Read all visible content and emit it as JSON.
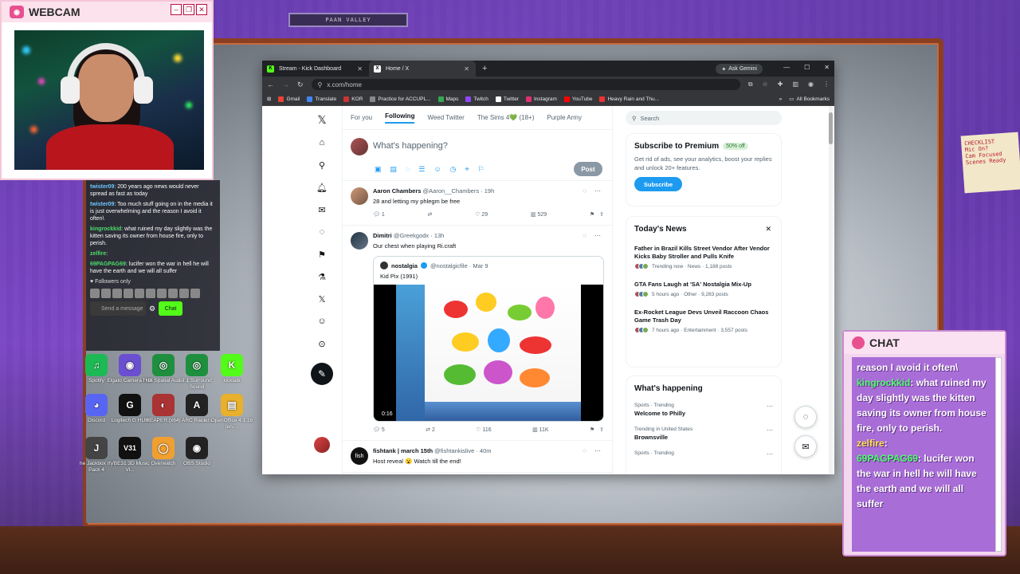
{
  "overlay": {
    "webcam_title": "WEBCAM",
    "chat_title": "CHAT",
    "sign_text": "PAAN VALLEY",
    "sticky_note": "CHECKLIST\nMic On?\nCam Focused\nScenes Ready"
  },
  "left_chat": {
    "messages": [
      {
        "user": "twister09",
        "text": ": 200 years ago news would never spread as fast as today"
      },
      {
        "user": "twister09",
        "text": ": Too much stuff going on in the media it is just overwhelming and the reason I avoid it often\\"
      },
      {
        "user": "kingrockkid",
        "text": ": what ruined my day slightly was the kitten saving its owner from house fire, only to perish."
      },
      {
        "user": "zelfire",
        "text": ":"
      },
      {
        "user": "69PAGPAG69",
        "text": ": lucifer won the war in hell he will have the earth and we will all suffer"
      }
    ],
    "followers_only": "Followers only",
    "send_placeholder": "Send a message",
    "chat_button": "Chat"
  },
  "right_chat": {
    "lines": [
      {
        "user": "",
        "text": "reason I avoid it often\\"
      },
      {
        "user": "kingrockkid",
        "text": ": what ruined my day slightly was the kitten saving its owner from house fire, only to perish."
      },
      {
        "user": "zelfire",
        "text": ":"
      },
      {
        "user": "69PAGPAG69",
        "text": ": lucifer won the war in hell he will have the earth and we will all suffer"
      }
    ]
  },
  "desktop_icons": [
    {
      "label": "Spotify",
      "color": "#1db954",
      "glyph": "♫"
    },
    {
      "label": "Elgato Camera Hub",
      "color": "#6a4fd0",
      "glyph": "◉"
    },
    {
      "label": "THX Spatial Audio",
      "color": "#1e8f3e",
      "glyph": "◎"
    },
    {
      "label": "7.1 Surround Sound",
      "color": "#1e8f3e",
      "glyph": "◎"
    },
    {
      "label": "kicklatk",
      "color": "#53fc18",
      "glyph": "K"
    },
    {
      "label": "Discord",
      "color": "#5865f2",
      "glyph": "◕"
    },
    {
      "label": "Logitech G HUB",
      "color": "#111111",
      "glyph": "G"
    },
    {
      "label": "REAPER (x64)",
      "color": "#a33",
      "glyph": "◐"
    },
    {
      "label": "ARC Raiders",
      "color": "#222222",
      "glyph": "A"
    },
    {
      "label": "OpenOffice 4.1.16 (en-...",
      "color": "#e8b02c",
      "glyph": "▤"
    },
    {
      "label": "he Jackbox rty Pack 4",
      "color": "#444",
      "glyph": "J"
    },
    {
      "label": "VBE31 3D Music Vi...",
      "color": "#111",
      "glyph": "V31"
    },
    {
      "label": "Overwatch",
      "color": "#f0a030",
      "glyph": "◯"
    },
    {
      "label": "OBS Studio",
      "color": "#222",
      "glyph": "◉"
    }
  ],
  "browser": {
    "tabs": [
      {
        "label": "Stream - Kick Dashboard",
        "active": false,
        "fav": "K",
        "fav_color": "#53fc18"
      },
      {
        "label": "Home / X",
        "active": true,
        "fav": "X",
        "fav_color": "#ffffff"
      }
    ],
    "ask_gemini": "Ask Gemini",
    "url": "x.com/home",
    "bookmarks": [
      {
        "label": "Gmail",
        "color": "#ea4335"
      },
      {
        "label": "Translate",
        "color": "#4285f4"
      },
      {
        "label": "KOR",
        "color": "#c33"
      },
      {
        "label": "Practice for ACCUPL...",
        "color": "#888"
      },
      {
        "label": "Maps",
        "color": "#34a853"
      },
      {
        "label": "Twitch",
        "color": "#9146ff"
      },
      {
        "label": "Twitter",
        "color": "#fff"
      },
      {
        "label": "Instagram",
        "color": "#e1306c"
      },
      {
        "label": "YouTube",
        "color": "#ff0000"
      },
      {
        "label": "Heavy Rain and Thu...",
        "color": "#e33"
      }
    ],
    "all_bookmarks": "All Bookmarks"
  },
  "x": {
    "timeline_tabs": [
      "For you",
      "Following",
      "Weed Twitter",
      "The Sims 4💚 (18+)",
      "Purple Army"
    ],
    "active_tab": 1,
    "compose_placeholder": "What's happening?",
    "post_button": "Post",
    "tweets": [
      {
        "name": "Aaron Chambers",
        "handle": "@Aaron__Chambers · 19h",
        "text": "28 and letting my phlegm be free",
        "replies": "1",
        "retweets": "",
        "likes": "29",
        "views": "529"
      },
      {
        "name": "Dimitri",
        "handle": "@Greekgodx · 13h",
        "text": "Our chest when playing Ri.craft",
        "quote_name": "nostalgia",
        "quote_handle": "@nostalgicfile · Mar 9",
        "quote_text": "Kid Pix (1991)",
        "video_time": "0:16",
        "replies": "5",
        "retweets": "2",
        "likes": "116",
        "views": "11K"
      },
      {
        "name": "fishtank | march 15th",
        "handle": "@fishtankislive · 40m",
        "text": "Host reveal 😮 Watch till the end!"
      }
    ],
    "search_placeholder": "Search",
    "premium": {
      "title": "Subscribe to Premium",
      "badge": "50% off",
      "desc": "Get rid of ads, see your analytics, boost your replies and unlock 20+ features.",
      "button": "Subscribe"
    },
    "news": {
      "title": "Today's News",
      "items": [
        {
          "headline": "Father in Brazil Kills Street Vendor After Vendor Kicks Baby Stroller and Pulls Knife",
          "meta": "Trending now · News · 1,188 posts"
        },
        {
          "headline": "GTA Fans Laugh at 'SA' Nostalgia Mix-Up",
          "meta": "5 hours ago · Other · 9,283 posts"
        },
        {
          "headline": "Ex-Rocket League Devs Unveil Raccoon Chaos Game Trash Day",
          "meta": "7 hours ago · Entertainment · 3,557 posts"
        }
      ]
    },
    "happening": {
      "title": "What's happening",
      "trends": [
        {
          "ctx": "Sports · Trending",
          "name": "Welcome to Philly"
        },
        {
          "ctx": "Trending in United States",
          "name": "Brownsville"
        },
        {
          "ctx": "Sports · Trending",
          "name": ""
        }
      ]
    }
  }
}
